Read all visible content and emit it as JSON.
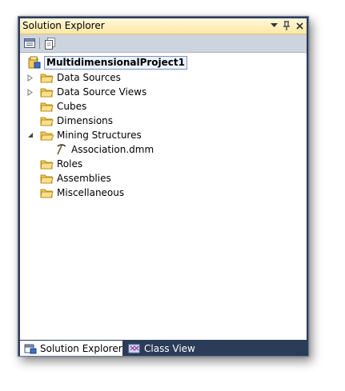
{
  "window": {
    "title": "Solution Explorer",
    "buttons": {
      "dropdown": "▾",
      "pin": "ᵖ",
      "close": "✕"
    }
  },
  "toolbar": {
    "items": [
      {
        "icon": "properties-icon"
      },
      {
        "icon": "show-all-files-icon"
      }
    ]
  },
  "tree": {
    "root": {
      "label": "MultidimensionalProject1",
      "icon": "project-icon"
    },
    "items": [
      {
        "label": "Data Sources",
        "icon": "folder-icon",
        "expander": "collapsed"
      },
      {
        "label": "Data Source Views",
        "icon": "folder-icon",
        "expander": "collapsed"
      },
      {
        "label": "Cubes",
        "icon": "folder-icon",
        "expander": "none"
      },
      {
        "label": "Dimensions",
        "icon": "folder-icon",
        "expander": "none"
      },
      {
        "label": "Mining Structures",
        "icon": "folder-icon",
        "expander": "expanded"
      },
      {
        "label": "Association.dmm",
        "icon": "mining-structure-icon",
        "expander": "none",
        "child": true
      },
      {
        "label": "Roles",
        "icon": "folder-icon",
        "expander": "none"
      },
      {
        "label": "Assemblies",
        "icon": "folder-icon",
        "expander": "none"
      },
      {
        "label": "Miscellaneous",
        "icon": "folder-icon",
        "expander": "none"
      }
    ]
  },
  "tabs": [
    {
      "label": "Solution Explorer",
      "icon": "solution-explorer-icon",
      "active": true
    },
    {
      "label": "Class View",
      "icon": "class-view-icon",
      "active": false
    }
  ],
  "colors": {
    "frame": "#2b3c59",
    "titlebar": "#ffe8a6",
    "toolbar": "#ced4df",
    "folder": "#f2c95a"
  }
}
